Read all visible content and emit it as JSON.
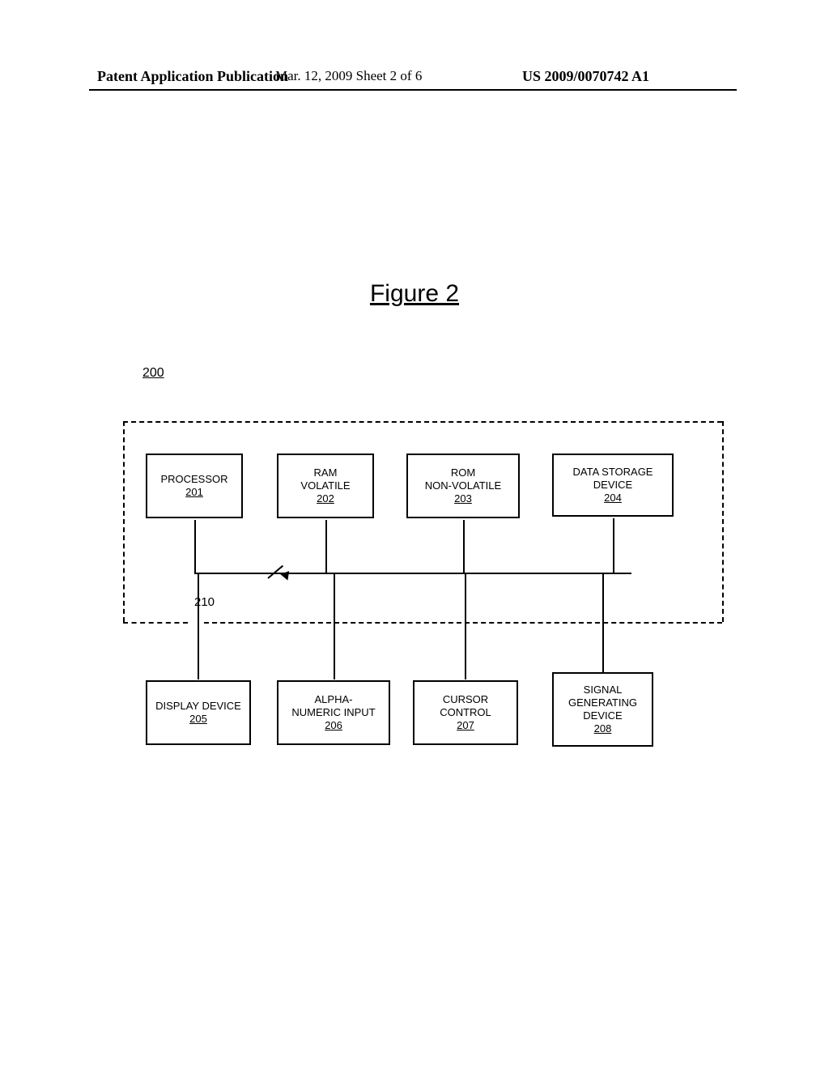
{
  "header": {
    "left": "Patent Application Publication",
    "center": "Mar. 12, 2009  Sheet 2 of 6",
    "right": "US 2009/0070742 A1"
  },
  "figure": {
    "title": "Figure 2",
    "ref": "200",
    "bus_label": "210"
  },
  "blocks": {
    "b201": {
      "label": "PROCESSOR",
      "num": "201"
    },
    "b202": {
      "label": "RAM\nVOLATILE",
      "num": "202"
    },
    "b203": {
      "label": "ROM\nNON-VOLATILE",
      "num": "203"
    },
    "b204": {
      "label": "DATA STORAGE\nDEVICE",
      "num": "204"
    },
    "b205": {
      "label": "DISPLAY DEVICE",
      "num": "205"
    },
    "b206": {
      "label": "ALPHA-\nNUMERIC INPUT",
      "num": "206"
    },
    "b207": {
      "label": "CURSOR\nCONTROL",
      "num": "207"
    },
    "b208": {
      "label": "SIGNAL\nGENERATING\nDEVICE",
      "num": "208"
    }
  }
}
